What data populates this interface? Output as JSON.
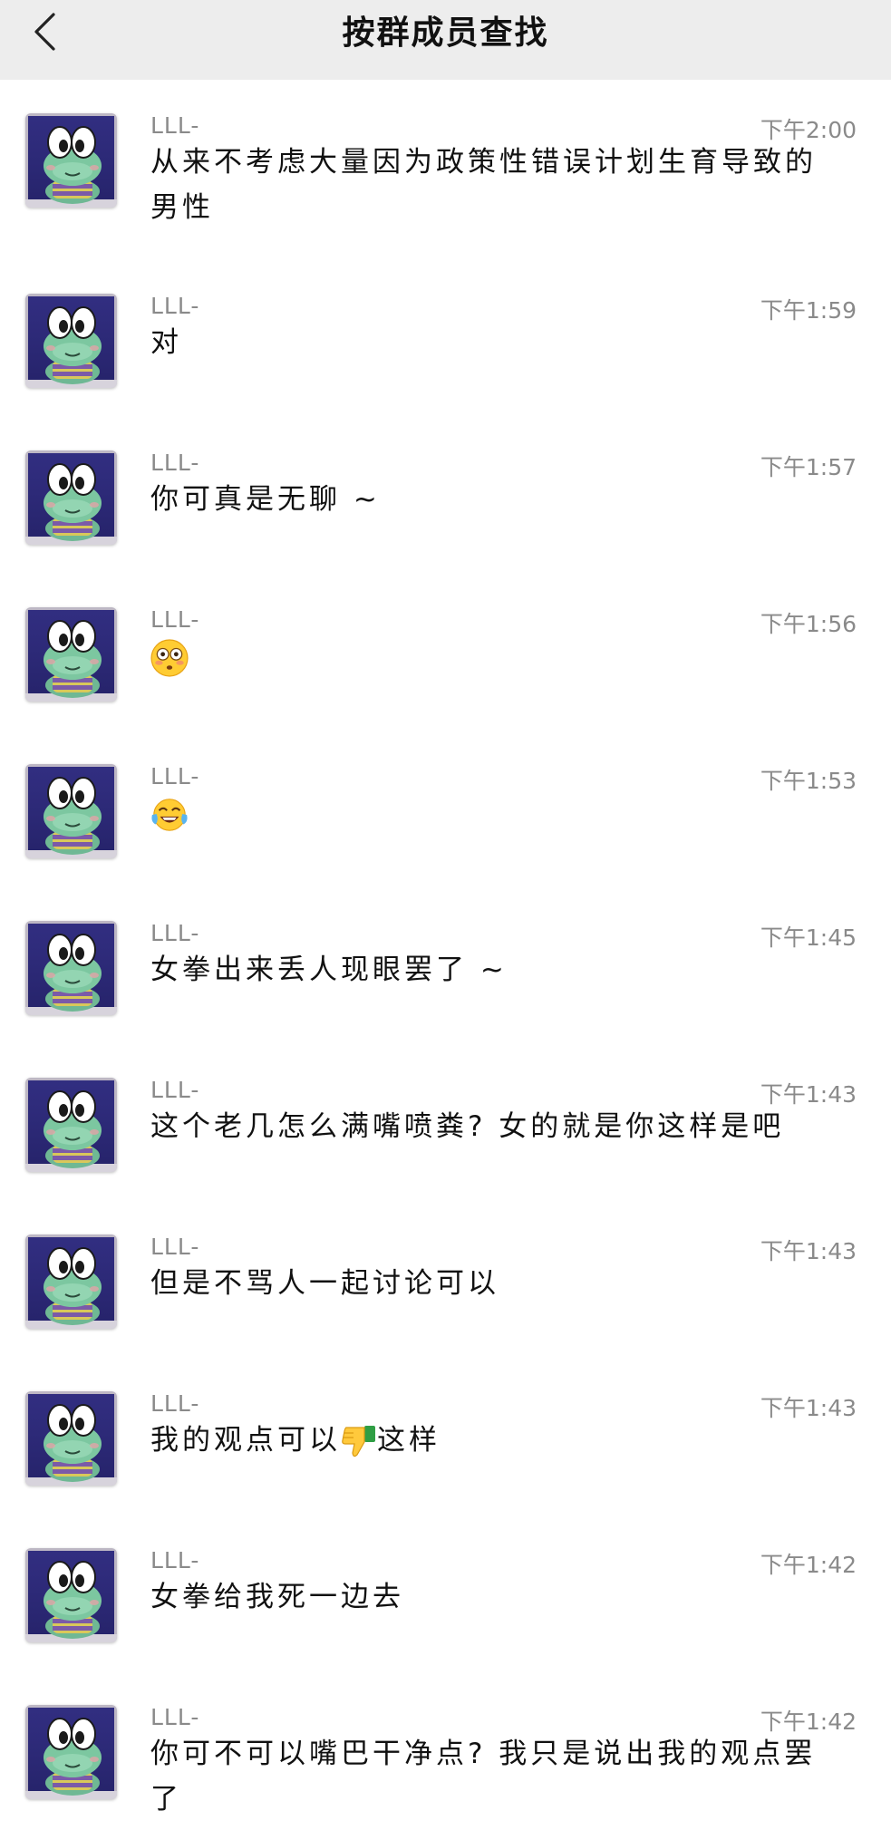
{
  "header": {
    "title": "按群成员查找",
    "back_icon": "chevron-left-icon"
  },
  "messages": [
    {
      "name": "LLL-",
      "time": "下午2:00",
      "text": "从来不考虑大量因为政策性错误计划生育导致的男性"
    },
    {
      "name": "LLL-",
      "time": "下午1:59",
      "text": "对"
    },
    {
      "name": "LLL-",
      "time": "下午1:57",
      "text": "你可真是无聊 ~"
    },
    {
      "name": "LLL-",
      "time": "下午1:56",
      "text": "",
      "emoji": "flushed-face-icon"
    },
    {
      "name": "LLL-",
      "time": "下午1:53",
      "text": "",
      "emoji": "tears-of-joy-icon"
    },
    {
      "name": "LLL-",
      "time": "下午1:45",
      "text": "女拳出来丢人现眼罢了 ~"
    },
    {
      "name": "LLL-",
      "time": "下午1:43",
      "text": "这个老几怎么满嘴喷粪? 女的就是你这样是吧"
    },
    {
      "name": "LLL-",
      "time": "下午1:43",
      "text": "但是不骂人一起讨论可以"
    },
    {
      "name": "LLL-",
      "time": "下午1:43",
      "text_before": "我的观点可以",
      "emoji": "thumbs-down-icon",
      "text_after": "这样"
    },
    {
      "name": "LLL-",
      "time": "下午1:42",
      "text": "女拳给我死一边去"
    },
    {
      "name": "LLL-",
      "time": "下午1:42",
      "text": "你可不可以嘴巴干净点? 我只是说出我的观点罢了"
    }
  ]
}
